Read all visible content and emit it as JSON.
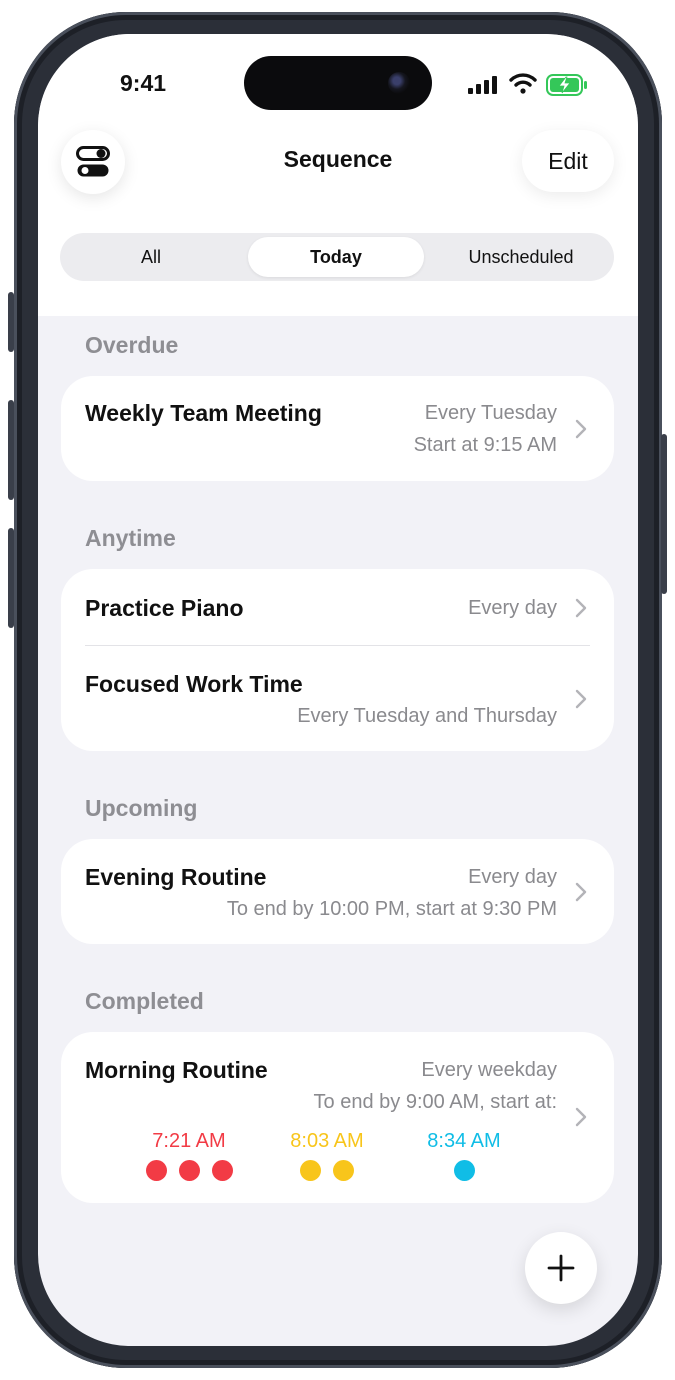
{
  "status_bar": {
    "time": "9:41"
  },
  "nav": {
    "title": "Sequence",
    "edit_label": "Edit"
  },
  "tabs": [
    {
      "label": "All",
      "selected": false
    },
    {
      "label": "Today",
      "selected": true
    },
    {
      "label": "Unscheduled",
      "selected": false
    }
  ],
  "sections": {
    "overdue": {
      "title": "Overdue",
      "items": [
        {
          "title": "Weekly Team Meeting",
          "schedule": "Every Tuesday",
          "detail": "Start at 9:15 AM"
        }
      ]
    },
    "anytime": {
      "title": "Anytime",
      "items": [
        {
          "title": "Practice Piano",
          "schedule": "Every day"
        },
        {
          "title": "Focused Work Time",
          "schedule": "Every Tuesday and Thursday"
        }
      ]
    },
    "upcoming": {
      "title": "Upcoming",
      "items": [
        {
          "title": "Evening Routine",
          "schedule": "Every day",
          "detail": "To end by 10:00 PM, start at 9:30 PM"
        }
      ]
    },
    "completed": {
      "title": "Completed",
      "items": [
        {
          "title": "Morning Routine",
          "schedule": "Every weekday",
          "detail": "To end by 9:00 AM, start at:",
          "start_times": [
            {
              "time": "7:21 AM",
              "dots": 3,
              "color": "#f23b45"
            },
            {
              "time": "8:03 AM",
              "dots": 2,
              "color": "#f8c51b"
            },
            {
              "time": "8:34 AM",
              "dots": 1,
              "color": "#10bde6"
            }
          ]
        }
      ]
    }
  },
  "icons": {
    "toggle": "toggles-icon",
    "chevron": "chevron-right-icon",
    "add": "plus-icon"
  },
  "colors": {
    "accent_battery": "#34c759",
    "secondary_text": "#8a8a8e"
  }
}
